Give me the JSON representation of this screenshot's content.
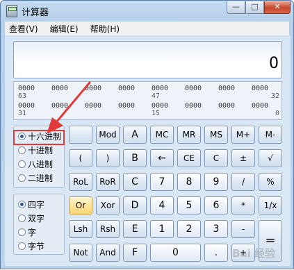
{
  "window": {
    "title": "计算器",
    "min": "—",
    "max": "□",
    "close": "✕"
  },
  "menu": [
    "查看(V)",
    "编辑(E)",
    "帮助(H)"
  ],
  "display": {
    "value": "0"
  },
  "bits": {
    "row1": [
      "0000",
      "0000",
      "0000",
      "0000",
      "0000",
      "0000",
      "0000",
      "0000"
    ],
    "row1_nums": [
      "63",
      "47",
      "32"
    ],
    "row2": [
      "0000",
      "0000",
      "0000",
      "0000",
      "0000",
      "0000",
      "0000",
      "0000"
    ],
    "row2_nums": [
      "31",
      "15",
      "0"
    ]
  },
  "base": {
    "options": [
      "十六进制",
      "十进制",
      "八进制",
      "二进制"
    ],
    "selected": "十六进制"
  },
  "word": {
    "options": [
      "四字",
      "双字",
      "字",
      "字节"
    ],
    "selected": "四字"
  },
  "keys": {
    "row1": [
      "",
      "Mod",
      "A",
      "MC",
      "MR",
      "MS",
      "M+",
      "M-"
    ],
    "row2": [
      "(",
      ")",
      "B",
      "←",
      "CE",
      "C",
      "±",
      "√"
    ],
    "row3": [
      "RoL",
      "RoR",
      "C",
      "7",
      "8",
      "9",
      "/",
      "%"
    ],
    "row4": [
      "Or",
      "Xor",
      "D",
      "4",
      "5",
      "6",
      "*",
      "1/x"
    ],
    "row5": [
      "Lsh",
      "Rsh",
      "E",
      "1",
      "2",
      "3",
      "-"
    ],
    "row6": [
      "Not",
      "And",
      "F",
      "0",
      "."
    ],
    "equals": "="
  },
  "colors": {
    "accent": "#2a5aa8",
    "highlight": "#e23a3a",
    "hot_key": "#fde59b"
  },
  "watermark": "Bai 经验"
}
